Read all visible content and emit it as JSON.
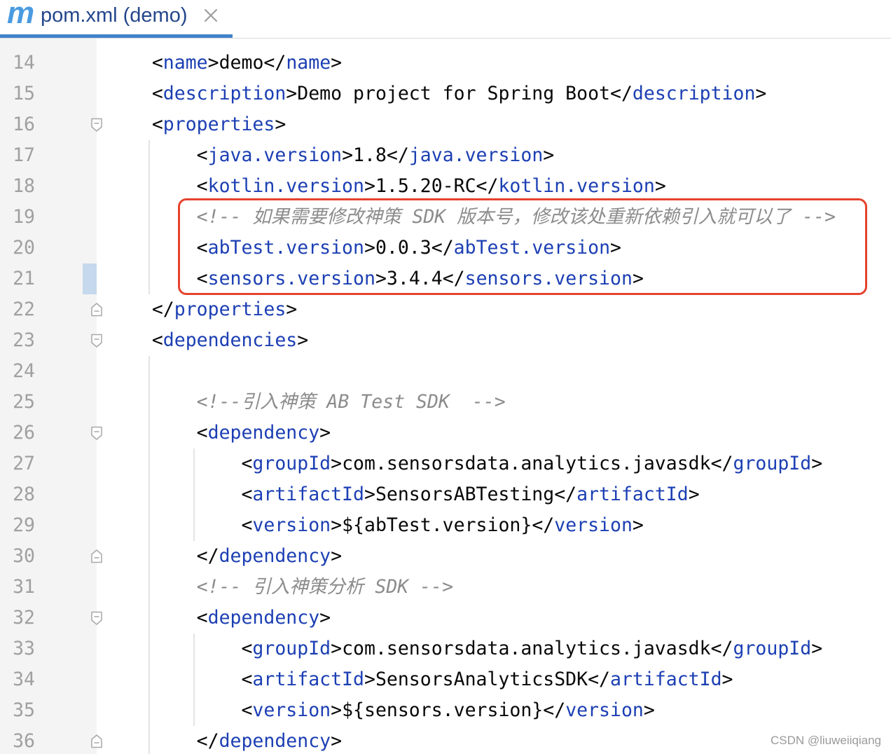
{
  "tab": {
    "icon": "maven-icon",
    "icon_letter": "m",
    "title": "pom.xml (demo)",
    "close_icon": "close-icon"
  },
  "editor": {
    "lines": [
      {
        "number": "14",
        "tokens": [
          {
            "ws": "    "
          },
          {
            "punct": "<"
          },
          {
            "tag": "name"
          },
          {
            "punct": ">"
          },
          {
            "text": "demo"
          },
          {
            "punct": "</"
          },
          {
            "tag": "name"
          },
          {
            "punct": ">"
          }
        ]
      },
      {
        "number": "15",
        "tokens": [
          {
            "ws": "    "
          },
          {
            "punct": "<"
          },
          {
            "tag": "description"
          },
          {
            "punct": ">"
          },
          {
            "text": "Demo project for Spring Boot"
          },
          {
            "punct": "</"
          },
          {
            "tag": "description"
          },
          {
            "punct": ">"
          }
        ]
      },
      {
        "number": "16",
        "fold": "fold-open-icon",
        "tokens": [
          {
            "ws": "    "
          },
          {
            "punct": "<"
          },
          {
            "tag": "properties"
          },
          {
            "punct": ">"
          }
        ]
      },
      {
        "number": "17",
        "tokens": [
          {
            "ws": "        "
          },
          {
            "punct": "<"
          },
          {
            "tag": "java.version"
          },
          {
            "punct": ">"
          },
          {
            "text": "1.8"
          },
          {
            "punct": "</"
          },
          {
            "tag": "java.version"
          },
          {
            "punct": ">"
          }
        ]
      },
      {
        "number": "18",
        "tokens": [
          {
            "ws": "        "
          },
          {
            "punct": "<"
          },
          {
            "tag": "kotlin.version"
          },
          {
            "punct": ">"
          },
          {
            "text": "1.5.20-RC"
          },
          {
            "punct": "</"
          },
          {
            "tag": "kotlin.version"
          },
          {
            "punct": ">"
          }
        ]
      },
      {
        "number": "19",
        "tokens": [
          {
            "ws": "        "
          },
          {
            "comment": "<!-- 如果需要修改神策 SDK 版本号，修改该处重新依赖引入就可以了 -->"
          }
        ]
      },
      {
        "number": "20",
        "tokens": [
          {
            "ws": "        "
          },
          {
            "punct": "<"
          },
          {
            "tag": "abTest.version"
          },
          {
            "punct": ">"
          },
          {
            "text": "0.0.3"
          },
          {
            "punct": "</"
          },
          {
            "tag": "abTest.version"
          },
          {
            "punct": ">"
          }
        ]
      },
      {
        "number": "21",
        "changed": true,
        "tokens": [
          {
            "ws": "        "
          },
          {
            "punct": "<"
          },
          {
            "tag": "sensors.version"
          },
          {
            "punct": ">"
          },
          {
            "text": "3.4.4"
          },
          {
            "punct": "</"
          },
          {
            "tag": "sensors.version"
          },
          {
            "punct": ">"
          }
        ]
      },
      {
        "number": "22",
        "fold": "fold-close-icon",
        "tokens": [
          {
            "ws": "    "
          },
          {
            "punct": "</"
          },
          {
            "tag": "properties"
          },
          {
            "punct": ">"
          }
        ]
      },
      {
        "number": "23",
        "fold": "fold-open-icon",
        "tokens": [
          {
            "ws": "    "
          },
          {
            "punct": "<"
          },
          {
            "tag": "dependencies"
          },
          {
            "punct": ">"
          }
        ]
      },
      {
        "number": "24",
        "tokens": []
      },
      {
        "number": "25",
        "tokens": [
          {
            "ws": "        "
          },
          {
            "comment": "<!--引入神策 AB Test SDK  -->"
          }
        ]
      },
      {
        "number": "26",
        "fold": "fold-open-icon",
        "tokens": [
          {
            "ws": "        "
          },
          {
            "punct": "<"
          },
          {
            "tag": "dependency"
          },
          {
            "punct": ">"
          }
        ]
      },
      {
        "number": "27",
        "tokens": [
          {
            "ws": "            "
          },
          {
            "punct": "<"
          },
          {
            "tag": "groupId"
          },
          {
            "punct": ">"
          },
          {
            "text": "com.sensorsdata.analytics.javasdk"
          },
          {
            "punct": "</"
          },
          {
            "tag": "groupId"
          },
          {
            "punct": ">"
          }
        ]
      },
      {
        "number": "28",
        "tokens": [
          {
            "ws": "            "
          },
          {
            "punct": "<"
          },
          {
            "tag": "artifactId"
          },
          {
            "punct": ">"
          },
          {
            "text": "SensorsABTesting"
          },
          {
            "punct": "</"
          },
          {
            "tag": "artifactId"
          },
          {
            "punct": ">"
          }
        ]
      },
      {
        "number": "29",
        "tokens": [
          {
            "ws": "            "
          },
          {
            "punct": "<"
          },
          {
            "tag": "version"
          },
          {
            "punct": ">"
          },
          {
            "text": "${abTest.version}"
          },
          {
            "punct": "</"
          },
          {
            "tag": "version"
          },
          {
            "punct": ">"
          }
        ]
      },
      {
        "number": "30",
        "fold": "fold-close-icon",
        "tokens": [
          {
            "ws": "        "
          },
          {
            "punct": "</"
          },
          {
            "tag": "dependency"
          },
          {
            "punct": ">"
          }
        ]
      },
      {
        "number": "31",
        "tokens": [
          {
            "ws": "        "
          },
          {
            "comment": "<!-- 引入神策分析 SDK -->"
          }
        ]
      },
      {
        "number": "32",
        "fold": "fold-open-icon",
        "tokens": [
          {
            "ws": "        "
          },
          {
            "punct": "<"
          },
          {
            "tag": "dependency"
          },
          {
            "punct": ">"
          }
        ]
      },
      {
        "number": "33",
        "tokens": [
          {
            "ws": "            "
          },
          {
            "punct": "<"
          },
          {
            "tag": "groupId"
          },
          {
            "punct": ">"
          },
          {
            "text": "com.sensorsdata.analytics.javasdk"
          },
          {
            "punct": "</"
          },
          {
            "tag": "groupId"
          },
          {
            "punct": ">"
          }
        ]
      },
      {
        "number": "34",
        "tokens": [
          {
            "ws": "            "
          },
          {
            "punct": "<"
          },
          {
            "tag": "artifactId"
          },
          {
            "punct": ">"
          },
          {
            "text": "SensorsAnalyticsSDK"
          },
          {
            "punct": "</"
          },
          {
            "tag": "artifactId"
          },
          {
            "punct": ">"
          }
        ]
      },
      {
        "number": "35",
        "tokens": [
          {
            "ws": "            "
          },
          {
            "punct": "<"
          },
          {
            "tag": "version"
          },
          {
            "punct": ">"
          },
          {
            "text": "${sensors.version}"
          },
          {
            "punct": "</"
          },
          {
            "tag": "version"
          },
          {
            "punct": ">"
          }
        ]
      },
      {
        "number": "36",
        "fold": "fold-close-icon",
        "tokens": [
          {
            "ws": "        "
          },
          {
            "punct": "</"
          },
          {
            "tag": "dependency"
          },
          {
            "punct": ">"
          }
        ]
      }
    ]
  },
  "watermark": "CSDN @liuweiiqiang",
  "colors": {
    "tag": "#1c3fb3",
    "punct": "#080808",
    "text": "#080808",
    "comment": "#8c8c8c",
    "line_number": "#a0a0a0",
    "gutter": "#f4f4f4",
    "changed_marker": "#c5d8ec",
    "fold_icon": "#a8a8a8",
    "indent_guide": "#e4e4e4",
    "highlight_box": "#e5432e",
    "tab_accent": "#4083c9",
    "tab_title": "#24468c",
    "maven_icon": "#4b9be0",
    "watermark": "#9a9a9a"
  }
}
